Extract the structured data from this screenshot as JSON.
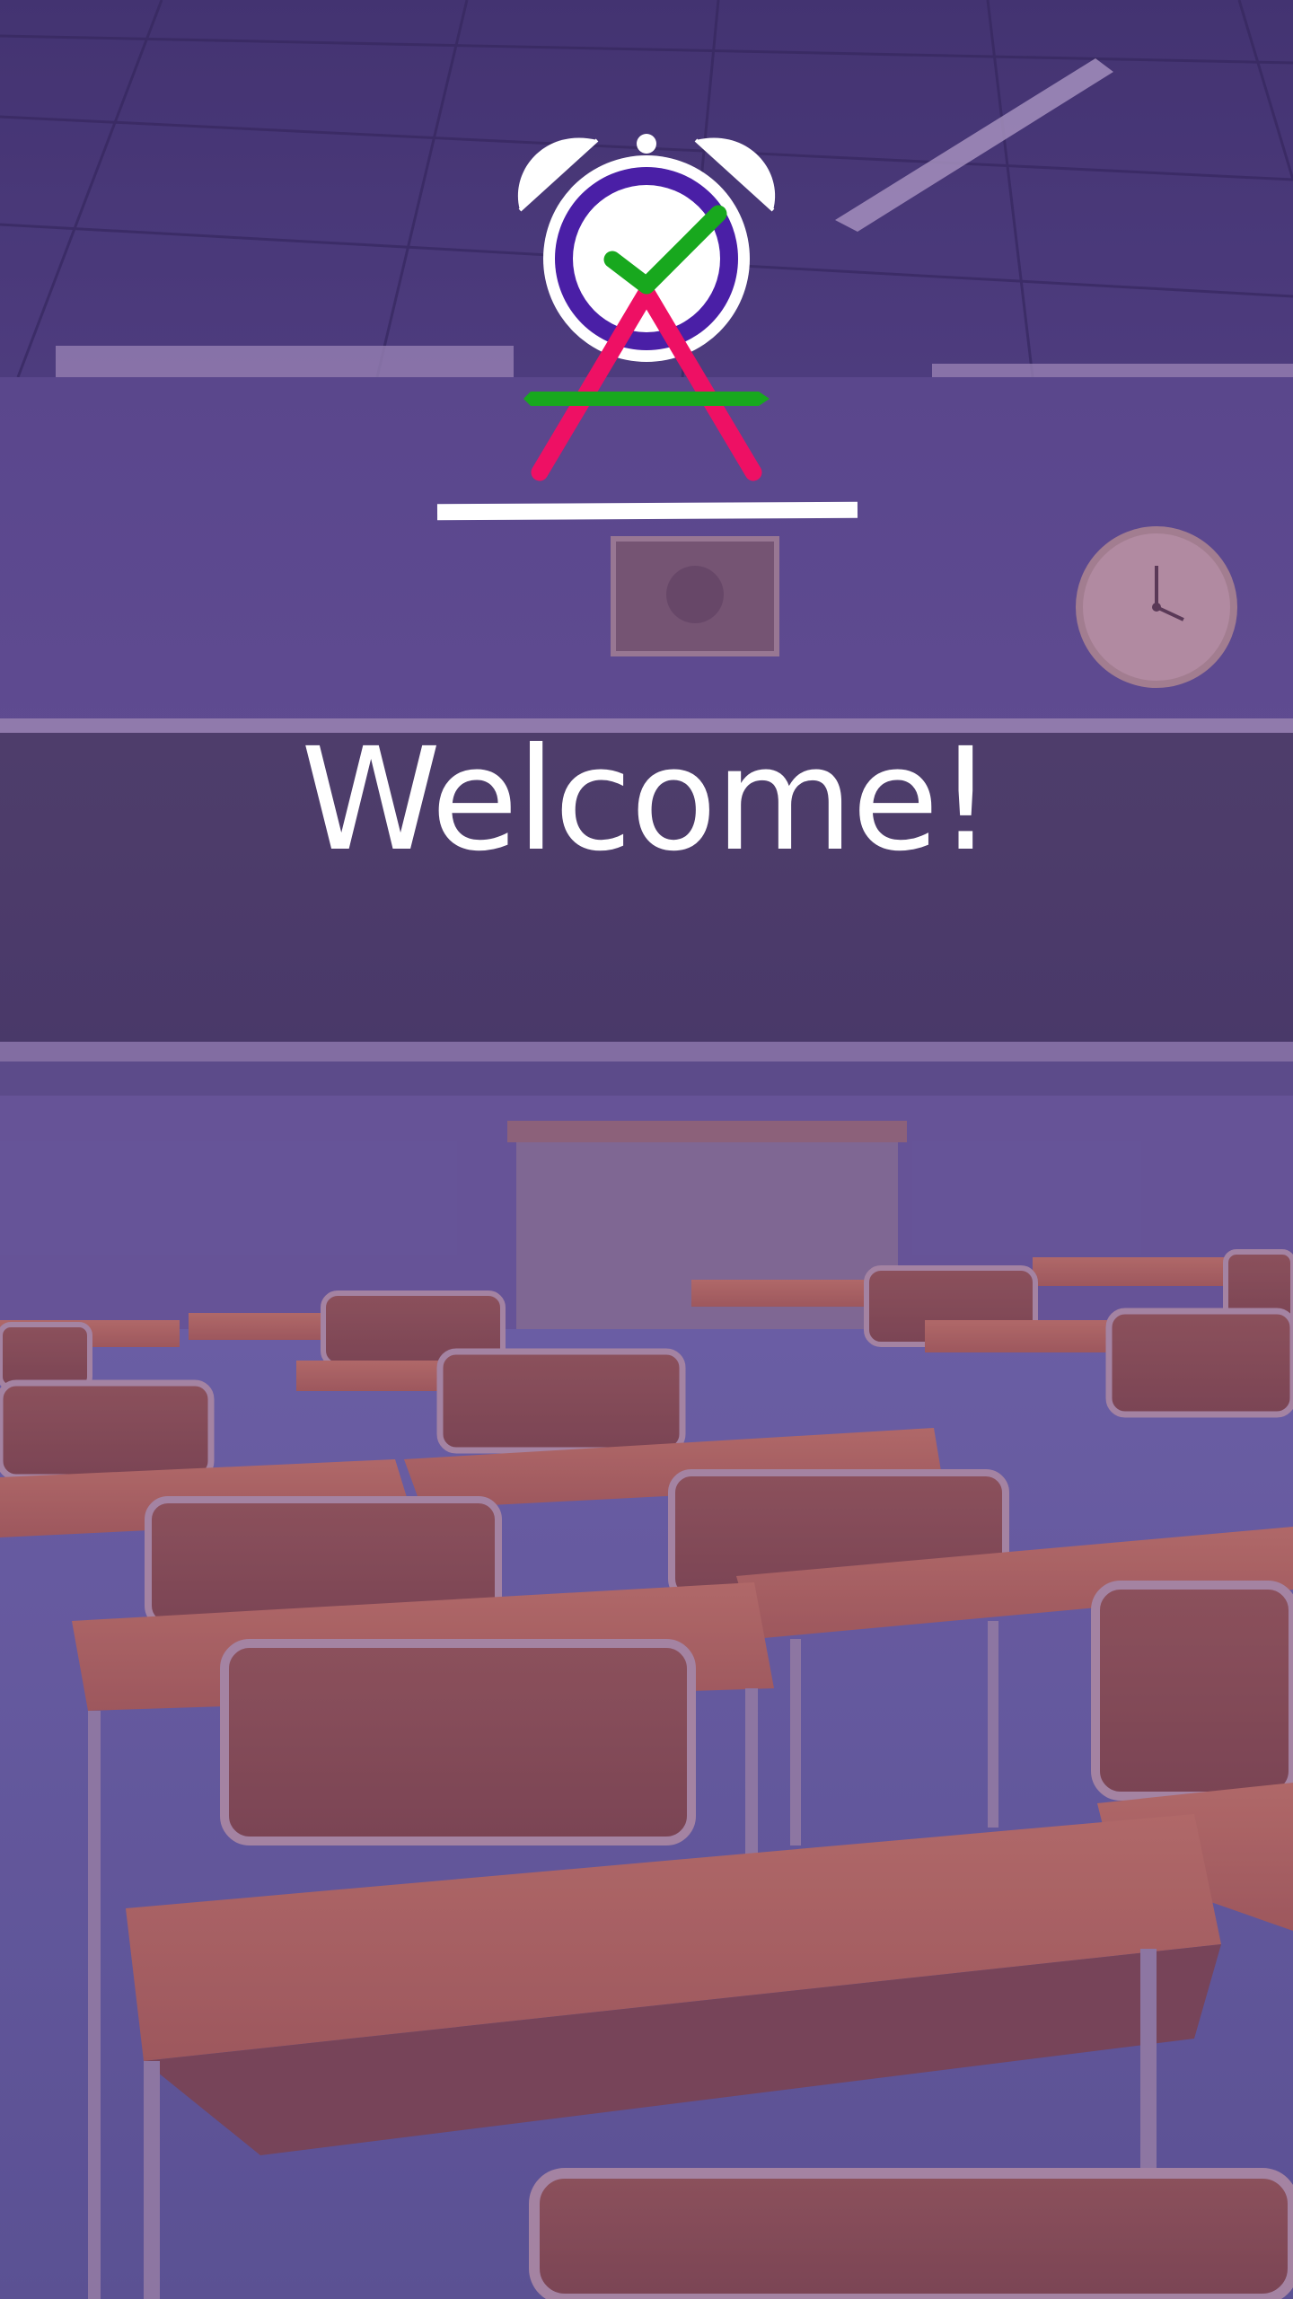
{
  "welcome": {
    "title": "Welcome!"
  },
  "logo": {
    "icon": "alarm-clock-check-app-logo",
    "colors": {
      "bells": "#ffffff",
      "ring": "#4a1fa6",
      "check": "#18a81e",
      "legs": "#ee1064",
      "bar": "#18a81e"
    }
  },
  "background": {
    "description_icon": "classroom-background-image",
    "tint": "#5a3296"
  }
}
